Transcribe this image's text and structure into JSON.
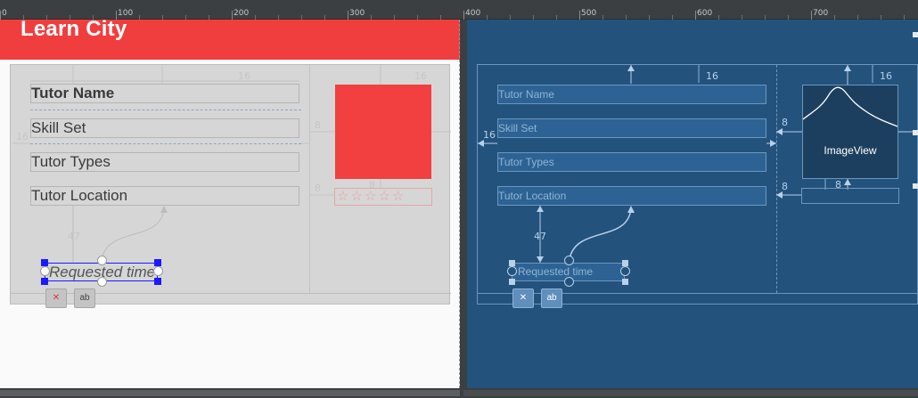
{
  "ruler": {
    "labels": [
      "0",
      "100",
      "200",
      "300",
      "400",
      "500",
      "600",
      "700"
    ]
  },
  "design": {
    "app_title": "Learn City",
    "fields": {
      "tutor_name": "Tutor Name",
      "skill_set": "Skill Set",
      "tutor_types": "Tutor Types",
      "tutor_location": "Tutor Location",
      "requested_time": "Requested time"
    },
    "margins": {
      "top_right": "16",
      "left": "16",
      "left_right": "8",
      "bottom_mid": "8",
      "vertical": "47"
    },
    "toolbar": {
      "clear_constraints_icon": "clear-constraints-icon",
      "baseline_label": "ab"
    },
    "colors": {
      "appbar": "#f03e3e",
      "image": "#f23f3f",
      "card": "#d6d6d6",
      "selection": "#1a1aff"
    }
  },
  "blueprint": {
    "fields": {
      "tutor_name": "Tutor Name",
      "skill_set": "Skill Set",
      "tutor_types": "Tutor Types",
      "tutor_location": "Tutor Location",
      "requested_time": "Requested time"
    },
    "image_label": "ImageView",
    "margins": {
      "top_left": "16",
      "top_right": "16",
      "left": "16",
      "img_left": "8",
      "bottom_left": "8",
      "bottom_mid": "8",
      "vertical": "47"
    },
    "toolbar": {
      "baseline_label": "ab"
    },
    "colors": {
      "background": "#23527c",
      "outline": "#6c96bf"
    }
  }
}
